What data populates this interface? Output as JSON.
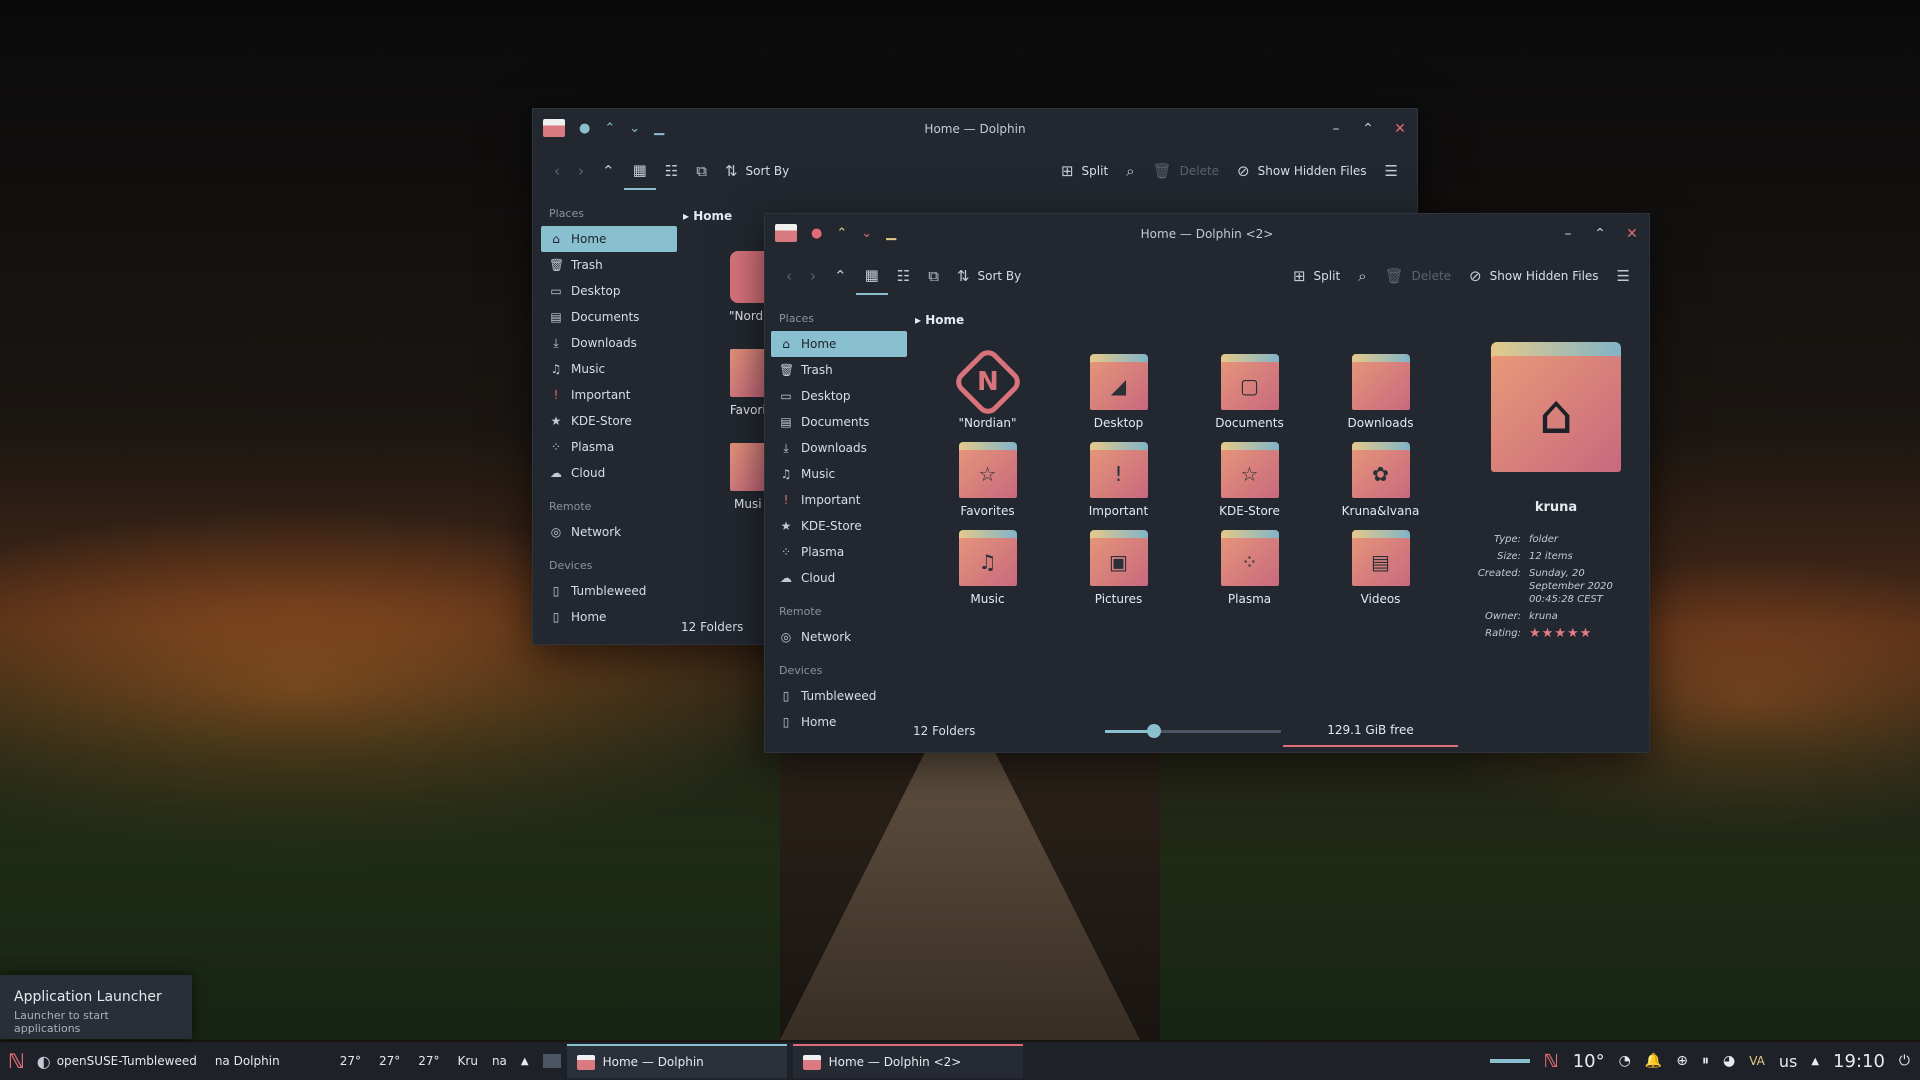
{
  "desktop": {
    "wallpaper": "sunset lake boardwalk"
  },
  "window_back": {
    "title": "Home — Dolphin",
    "toolbar": {
      "sort_by": "Sort By",
      "split": "Split",
      "delete": "Delete",
      "show_hidden": "Show Hidden Files"
    },
    "places_header": "Places",
    "places": [
      {
        "icon": "home-icon",
        "label": "Home",
        "selected": true
      },
      {
        "icon": "trash-icon",
        "label": "Trash"
      },
      {
        "icon": "desktop-icon",
        "label": "Desktop"
      },
      {
        "icon": "documents-icon",
        "label": "Documents"
      },
      {
        "icon": "downloads-icon",
        "label": "Downloads"
      },
      {
        "icon": "music-icon",
        "label": "Music"
      },
      {
        "icon": "important-icon",
        "label": "Important"
      },
      {
        "icon": "star-icon",
        "label": "KDE-Store"
      },
      {
        "icon": "plasma-icon",
        "label": "Plasma"
      },
      {
        "icon": "cloud-icon",
        "label": "Cloud"
      }
    ],
    "remote_header": "Remote",
    "remote": [
      {
        "icon": "network-icon",
        "label": "Network"
      }
    ],
    "devices_header": "Devices",
    "devices": [
      {
        "icon": "drive-icon",
        "label": "Tumbleweed"
      },
      {
        "icon": "drive-icon",
        "label": "Home"
      }
    ],
    "breadcrumb": "Home",
    "partial_items": [
      "\"Nordi",
      "Favori",
      "Musi"
    ],
    "status": "12 Folders"
  },
  "window_front": {
    "title": "Home — Dolphin <2>",
    "toolbar": {
      "sort_by": "Sort By",
      "split": "Split",
      "delete": "Delete",
      "show_hidden": "Show Hidden Files"
    },
    "places_header": "Places",
    "places": [
      {
        "icon": "home-icon",
        "label": "Home",
        "selected": true
      },
      {
        "icon": "trash-icon",
        "label": "Trash"
      },
      {
        "icon": "desktop-icon",
        "label": "Desktop"
      },
      {
        "icon": "documents-icon",
        "label": "Documents"
      },
      {
        "icon": "downloads-icon",
        "label": "Downloads"
      },
      {
        "icon": "music-icon",
        "label": "Music"
      },
      {
        "icon": "important-icon",
        "label": "Important"
      },
      {
        "icon": "star-icon",
        "label": "KDE-Store"
      },
      {
        "icon": "plasma-icon",
        "label": "Plasma"
      },
      {
        "icon": "cloud-icon",
        "label": "Cloud"
      }
    ],
    "remote_header": "Remote",
    "remote": [
      {
        "icon": "network-icon",
        "label": "Network"
      }
    ],
    "devices_header": "Devices",
    "devices": [
      {
        "icon": "drive-icon",
        "label": "Tumbleweed"
      },
      {
        "icon": "drive-icon",
        "label": "Home"
      }
    ],
    "breadcrumb": "Home",
    "items": [
      {
        "label": "\"Nordian\"",
        "glyph": "N",
        "kind": "logo"
      },
      {
        "label": "Desktop",
        "glyph": "◢",
        "kind": "folder"
      },
      {
        "label": "Documents",
        "glyph": "▢",
        "kind": "folder"
      },
      {
        "label": "Downloads",
        "glyph": "",
        "kind": "folder"
      },
      {
        "label": "Favorites",
        "glyph": "☆",
        "kind": "folder"
      },
      {
        "label": "Important",
        "glyph": "!",
        "kind": "folder"
      },
      {
        "label": "KDE-Store",
        "glyph": "☆",
        "kind": "folder"
      },
      {
        "label": "Kruna&Ivana",
        "glyph": "✿",
        "kind": "folder"
      },
      {
        "label": "Music",
        "glyph": "♫",
        "kind": "folder"
      },
      {
        "label": "Pictures",
        "glyph": "▣",
        "kind": "folder"
      },
      {
        "label": "Plasma",
        "glyph": "⁘",
        "kind": "folder"
      },
      {
        "label": "Videos",
        "glyph": "▤",
        "kind": "folder"
      }
    ],
    "info": {
      "name": "kruna",
      "type_label": "Type:",
      "type": "folder",
      "size_label": "Size:",
      "size": "12 items",
      "created_label": "Created:",
      "created": "Sunday, 20 September 2020 00:45:28 CEST",
      "owner_label": "Owner:",
      "owner": "kruna",
      "rating_label": "Rating:",
      "rating": 5,
      "rating_max": 5
    },
    "status": "12 Folders",
    "zoom_value": 0.28,
    "free_space": "129.1 GiB free",
    "free_used_fraction": 0.0
  },
  "tooltip": {
    "title": "Application Launcher",
    "subtitle": "Launcher to start applications"
  },
  "taskbar": {
    "distro": "openSUSE-Tumbleweed",
    "active_app": "na Dolphin",
    "temps": [
      "27°",
      "27°",
      "27°"
    ],
    "short1": "Kru",
    "short2": "na",
    "task1": "Home — Dolphin",
    "task2": "Home — Dolphin <2>",
    "weather": "10°",
    "lang": "us",
    "clock": "19:10"
  },
  "colors": {
    "accent": "#88c0d0",
    "close": "#e06c75",
    "bg": "#232830"
  }
}
